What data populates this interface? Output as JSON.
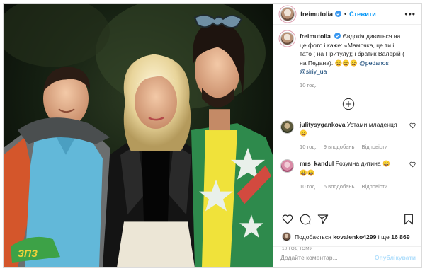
{
  "post": {
    "author": "freimutolia",
    "follow_label": "Стежити",
    "more_label": "•••"
  },
  "caption": {
    "author": "freimutolia",
    "text": "Євдокія дивиться на це фото і каже: «Мамочка, це ти і тато ( на Притулу); і братик Валерій ( на Педана).",
    "emoji": "😄😄😄",
    "mentions": [
      "@pedanos",
      "@siriy_ua"
    ],
    "time": "10 год."
  },
  "comments": [
    {
      "user": "julitysygankova",
      "text": "Устами младенця",
      "emoji": "😄",
      "time": "10 год.",
      "likes": "9 вподобань",
      "reply": "Відповісти"
    },
    {
      "user": "mrs_kandul",
      "text": "Розумна дитина",
      "emoji": "😄",
      "emoji_line2": "😄😄",
      "time": "10 год.",
      "likes": "6 вподобань",
      "reply": "Відповісти"
    }
  ],
  "likes": {
    "prefix": "Подобається",
    "user": "kovalenko4299",
    "conj": "і ще",
    "count": "16 869"
  },
  "posted_ago": "10 год тому",
  "add_comment": {
    "placeholder": "Додайте коментар...",
    "publish_label": "Опублікувати"
  },
  "colors": {
    "accent": "#0095f6",
    "publish_disabled": "#b2dffc",
    "muted": "#8e8e8e",
    "mention": "#00376b"
  },
  "icons": [
    "verified-badge-icon",
    "more-options-icon",
    "load-more-comments-icon",
    "heart-icon",
    "comment-icon",
    "share-icon",
    "bookmark-icon"
  ]
}
